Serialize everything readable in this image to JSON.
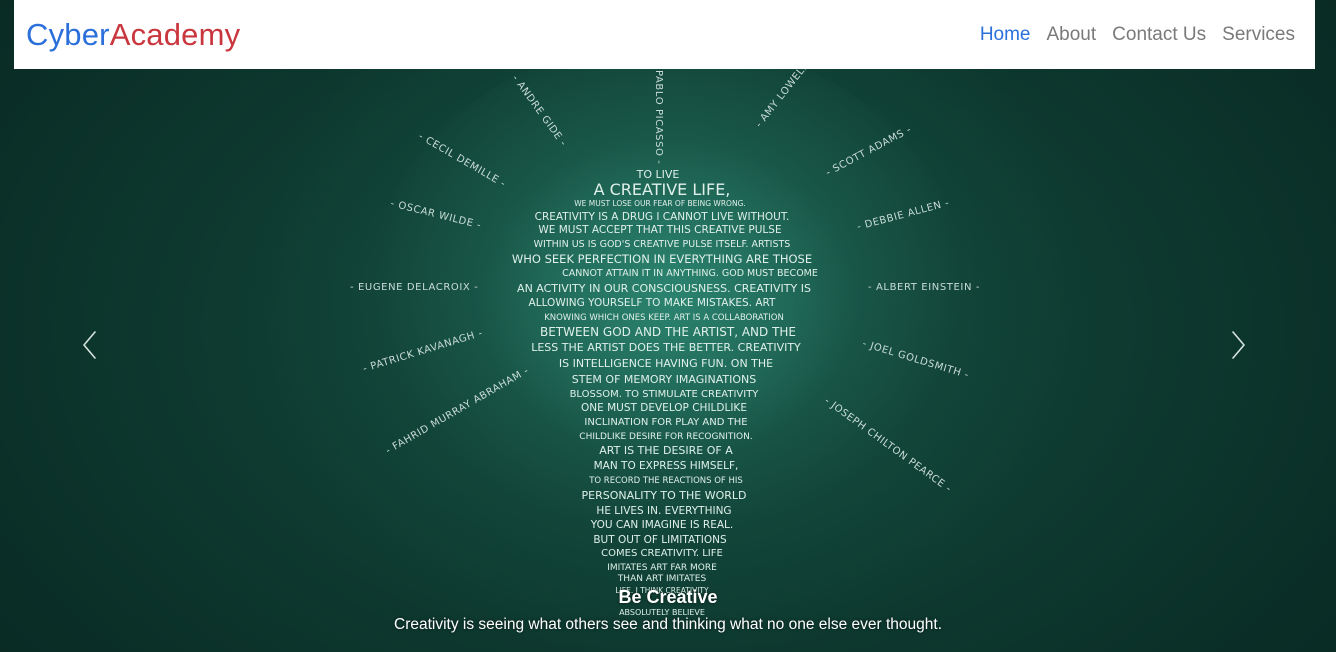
{
  "navbar": {
    "brand_part1": "Cyber",
    "brand_part2": "Academy",
    "links": [
      {
        "label": "Home",
        "active": true
      },
      {
        "label": "About",
        "active": false
      },
      {
        "label": "Contact Us",
        "active": false
      },
      {
        "label": "Services",
        "active": false
      }
    ],
    "colors": {
      "brand_blue": "#2b6fdb",
      "brand_red": "#c9363e",
      "link_gray": "#7a7a7a"
    }
  },
  "carousel": {
    "slide": {
      "image_rays": [
        "- ANDRE GIDE -",
        "PABLO PICASSO -",
        "- AMY LOWELL -",
        "- CECIL DEMILLE -",
        "- SCOTT ADAMS -",
        "- OSCAR WILDE -",
        "- DEBBIE ALLEN -",
        "- EUGENE DELACROIX -",
        "- ALBERT EINSTEIN -",
        "- PATRICK KAVANAGH -",
        "- JOEL GOLDSMITH -",
        "- FAHRID MURRAY ABRAHAM -",
        "- JOSEPH CHILTON PEARCE -"
      ],
      "image_bulb_lines": [
        "TO LIVE",
        "A CREATIVE LIFE,",
        "WE MUST LOSE OUR FEAR OF BEING WRONG.",
        "CREATIVITY IS A DRUG I CANNOT LIVE WITHOUT.",
        "WE MUST ACCEPT THAT THIS CREATIVE PULSE",
        "WITHIN US IS GOD'S CREATIVE PULSE ITSELF. ARTISTS",
        "WHO SEEK PERFECTION IN EVERYTHING ARE THOSE",
        "CANNOT ATTAIN IT IN ANYTHING. GOD MUST BECOME",
        "AN ACTIVITY IN OUR CONSCIOUSNESS. CREATIVITY IS",
        "ALLOWING YOURSELF TO MAKE MISTAKES. ART",
        "KNOWING WHICH ONES KEEP. ART IS A COLLABORATION",
        "BETWEEN GOD AND THE ARTIST, AND THE",
        "LESS THE ARTIST DOES THE BETTER. CREATIVITY",
        "IS INTELLIGENCE HAVING FUN. ON THE",
        "STEM OF MEMORY IMAGINATIONS",
        "BLOSSOM. TO STIMULATE CREATIVITY",
        "ONE MUST DEVELOP CHILDLIKE",
        "INCLINATION FOR PLAY AND THE",
        "CHILDLIKE DESIRE FOR RECOGNITION.",
        "ART IS THE DESIRE OF A",
        "MAN TO EXPRESS HIMSELF,",
        "TO RECORD THE REACTIONS OF HIS",
        "PERSONALITY TO THE WORLD",
        "HE LIVES IN. EVERYTHING",
        "YOU CAN IMAGINE IS REAL.",
        "BUT OUT OF LIMITATIONS",
        "COMES CREATIVITY. LIFE",
        "IMITATES ART FAR MORE",
        "THAN ART IMITATES",
        "LIFE. I THINK CREATIVITY",
        "ABSOLUTELY BELIEVE"
      ],
      "caption_title": "Be Creative",
      "caption_text": "Creativity is seeing what others see and thinking what no one else ever thought."
    },
    "controls": {
      "prev_icon": "chevron-left-icon",
      "next_icon": "chevron-right-icon"
    }
  }
}
